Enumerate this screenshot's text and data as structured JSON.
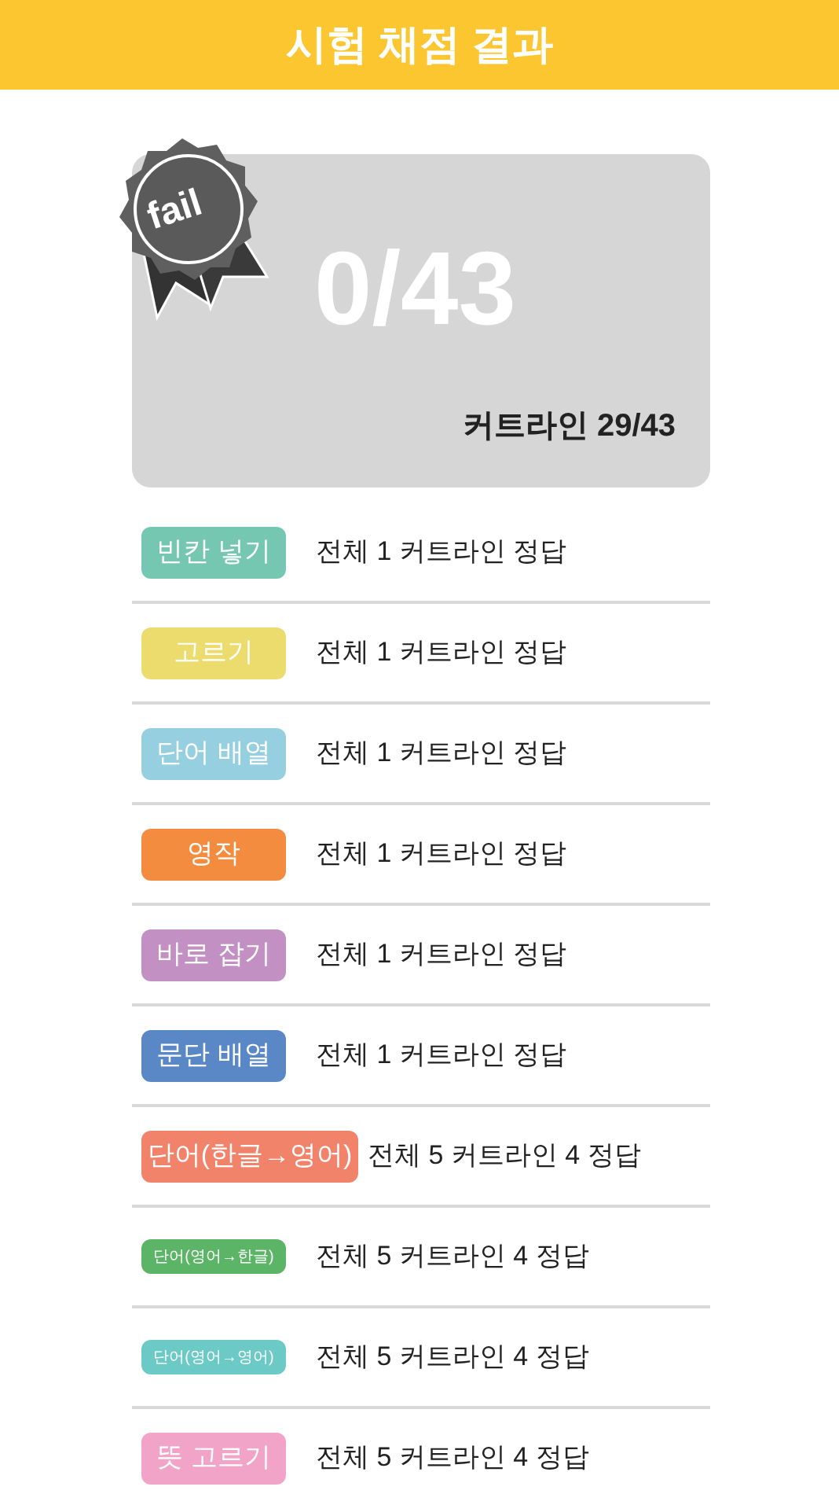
{
  "header": {
    "title": "시험 채점 결과"
  },
  "score_card": {
    "badge": "fail",
    "score": "0/43",
    "cutline": "커트라인 29/43"
  },
  "results": [
    {
      "tag": "빈칸 넣기",
      "kind": "normal",
      "color": "#76c7b1",
      "summary": "전체 1 커트라인  정답"
    },
    {
      "tag": "고르기",
      "kind": "normal",
      "color": "#ecdc6e",
      "summary": "전체 1 커트라인  정답"
    },
    {
      "tag": "단어 배열",
      "kind": "normal",
      "color": "#95cfe0",
      "summary": "전체 1 커트라인  정답"
    },
    {
      "tag": "영작",
      "kind": "normal",
      "color": "#f38c3e",
      "summary": "전체 1 커트라인  정답"
    },
    {
      "tag": "바로 잡기",
      "kind": "normal",
      "color": "#c390c4",
      "summary": "전체 1 커트라인  정답"
    },
    {
      "tag": "문단 배열",
      "kind": "normal",
      "color": "#5a87c5",
      "summary": "전체 1 커트라인  정답"
    },
    {
      "tag": "단어(한글→영어)",
      "kind": "wide",
      "color": "#f2836b",
      "summary": "전체 5 커트라인 4 정답"
    },
    {
      "tag": "단어(영어→한글)",
      "kind": "small",
      "color": "#5cb467",
      "summary": "전체 5 커트라인 4 정답"
    },
    {
      "tag": "단어(영어→영어)",
      "kind": "small",
      "color": "#6ccac6",
      "summary": "전체 5 커트라인 4 정답"
    },
    {
      "tag": "뜻 고르기",
      "kind": "normal",
      "color": "#f2a4c8",
      "summary": "전체 5 커트라인 4 정답"
    }
  ]
}
